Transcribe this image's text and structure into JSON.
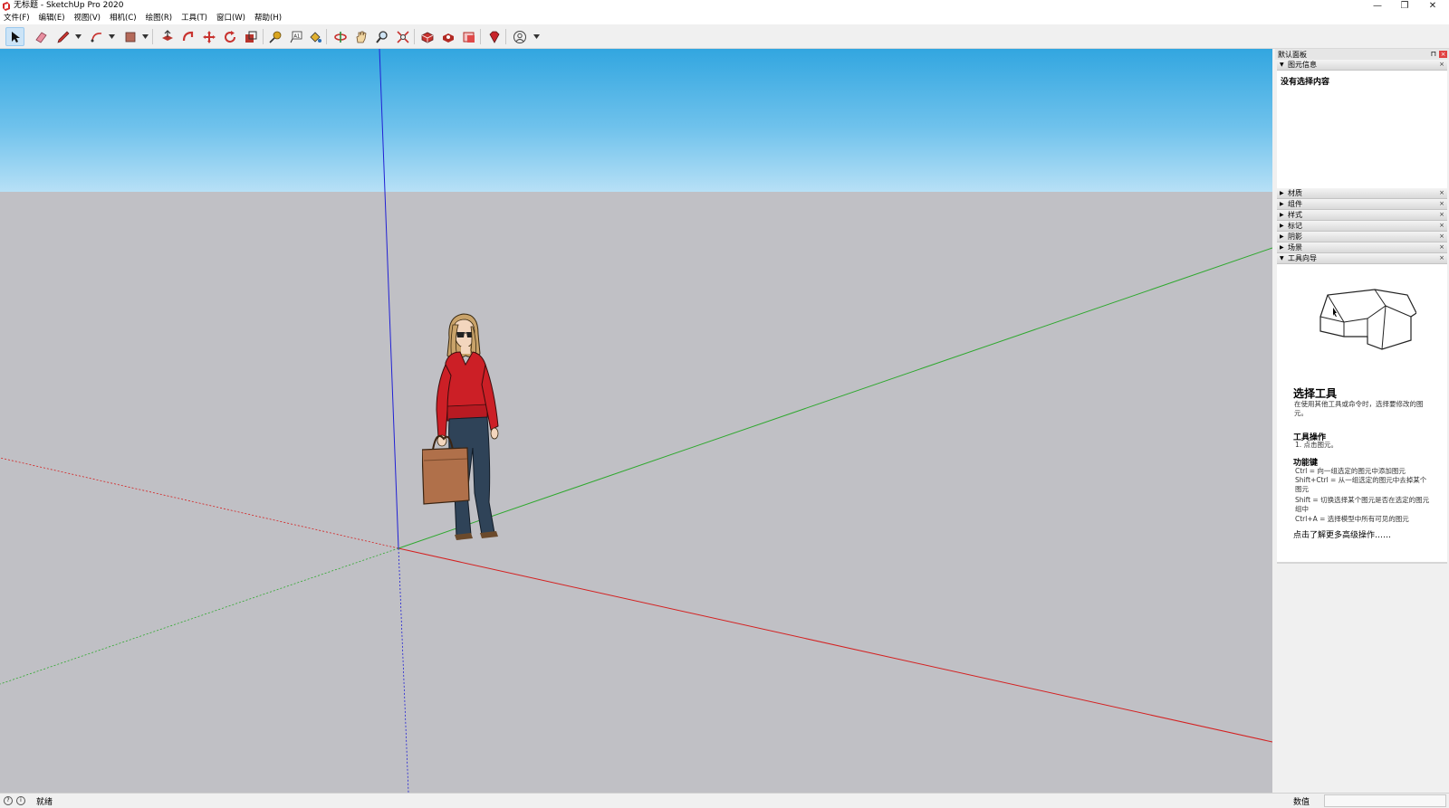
{
  "window": {
    "title": "无标题 - SketchUp Pro 2020",
    "controls": {
      "minimize": "—",
      "restore": "❐",
      "close": "✕"
    }
  },
  "menu": [
    "文件(F)",
    "编辑(E)",
    "视图(V)",
    "相机(C)",
    "绘图(R)",
    "工具(T)",
    "窗口(W)",
    "帮助(H)"
  ],
  "toolbar": {
    "tools": [
      {
        "name": "select-tool",
        "icon": "arrow-cursor-icon",
        "active": true
      },
      {
        "name": "eraser-tool",
        "icon": "eraser-icon"
      },
      {
        "name": "line-tool",
        "icon": "pencil-icon"
      },
      {
        "name": "arc-tool",
        "icon": "arc-icon"
      },
      {
        "name": "shapes-tool",
        "icon": "rectangle-icon"
      },
      {
        "name": "push-pull-tool",
        "icon": "push-pull-icon"
      },
      {
        "name": "follow-me-tool",
        "icon": "follow-me-icon"
      },
      {
        "name": "move-tool",
        "icon": "move-icon"
      },
      {
        "name": "rotate-tool",
        "icon": "rotate-icon"
      },
      {
        "name": "scale-tool",
        "icon": "scale-icon"
      },
      {
        "name": "tape-measure-tool",
        "icon": "tape-measure-icon"
      },
      {
        "name": "text-tool",
        "icon": "text-icon"
      },
      {
        "name": "paint-bucket-tool",
        "icon": "paint-bucket-icon"
      },
      {
        "name": "orbit-tool",
        "icon": "orbit-icon"
      },
      {
        "name": "pan-tool",
        "icon": "hand-icon"
      },
      {
        "name": "zoom-tool",
        "icon": "magnifier-icon"
      },
      {
        "name": "zoom-extents-tool",
        "icon": "zoom-extents-icon"
      },
      {
        "name": "3d-warehouse-button",
        "icon": "warehouse-icon"
      },
      {
        "name": "extension-warehouse-button",
        "icon": "extension-warehouse-icon"
      },
      {
        "name": "send-to-layout-button",
        "icon": "layout-icon"
      },
      {
        "name": "extension-manager-button",
        "icon": "ruby-icon"
      },
      {
        "name": "account-button",
        "icon": "user-icon"
      }
    ]
  },
  "tray": {
    "title": "默认面板",
    "entity_info": {
      "label": "图元信息",
      "empty_text": "没有选择内容"
    },
    "sections": [
      "材质",
      "组件",
      "样式",
      "标记",
      "阴影",
      "场景"
    ],
    "instructor": {
      "label": "工具向导",
      "tool_title": "选择工具",
      "tool_desc": "在使用其他工具或命令时，选择要修改的图元。",
      "ops_heading": "工具操作",
      "ops_lines": [
        "1. 点击图元。"
      ],
      "keys_heading": "功能键",
      "keys_lines": [
        "Ctrl = 向一组选定的图元中添加图元",
        "Shift+Ctrl = 从一组选定的图元中去掉某个图元",
        "Shift = 切换选择某个图元是否在选定的图元组中",
        "Ctrl+A = 选择模型中所有可见的图元"
      ],
      "more_link": "点击了解更多高级操作……"
    }
  },
  "status": {
    "text": "就绪",
    "measurements_label": "数值",
    "measurements_value": ""
  },
  "colors": {
    "sky_top": "#32a6e0",
    "ground": "#c0c0c5",
    "axis_red": "#d42020",
    "axis_green": "#2ea82e",
    "axis_blue": "#2020d4"
  }
}
